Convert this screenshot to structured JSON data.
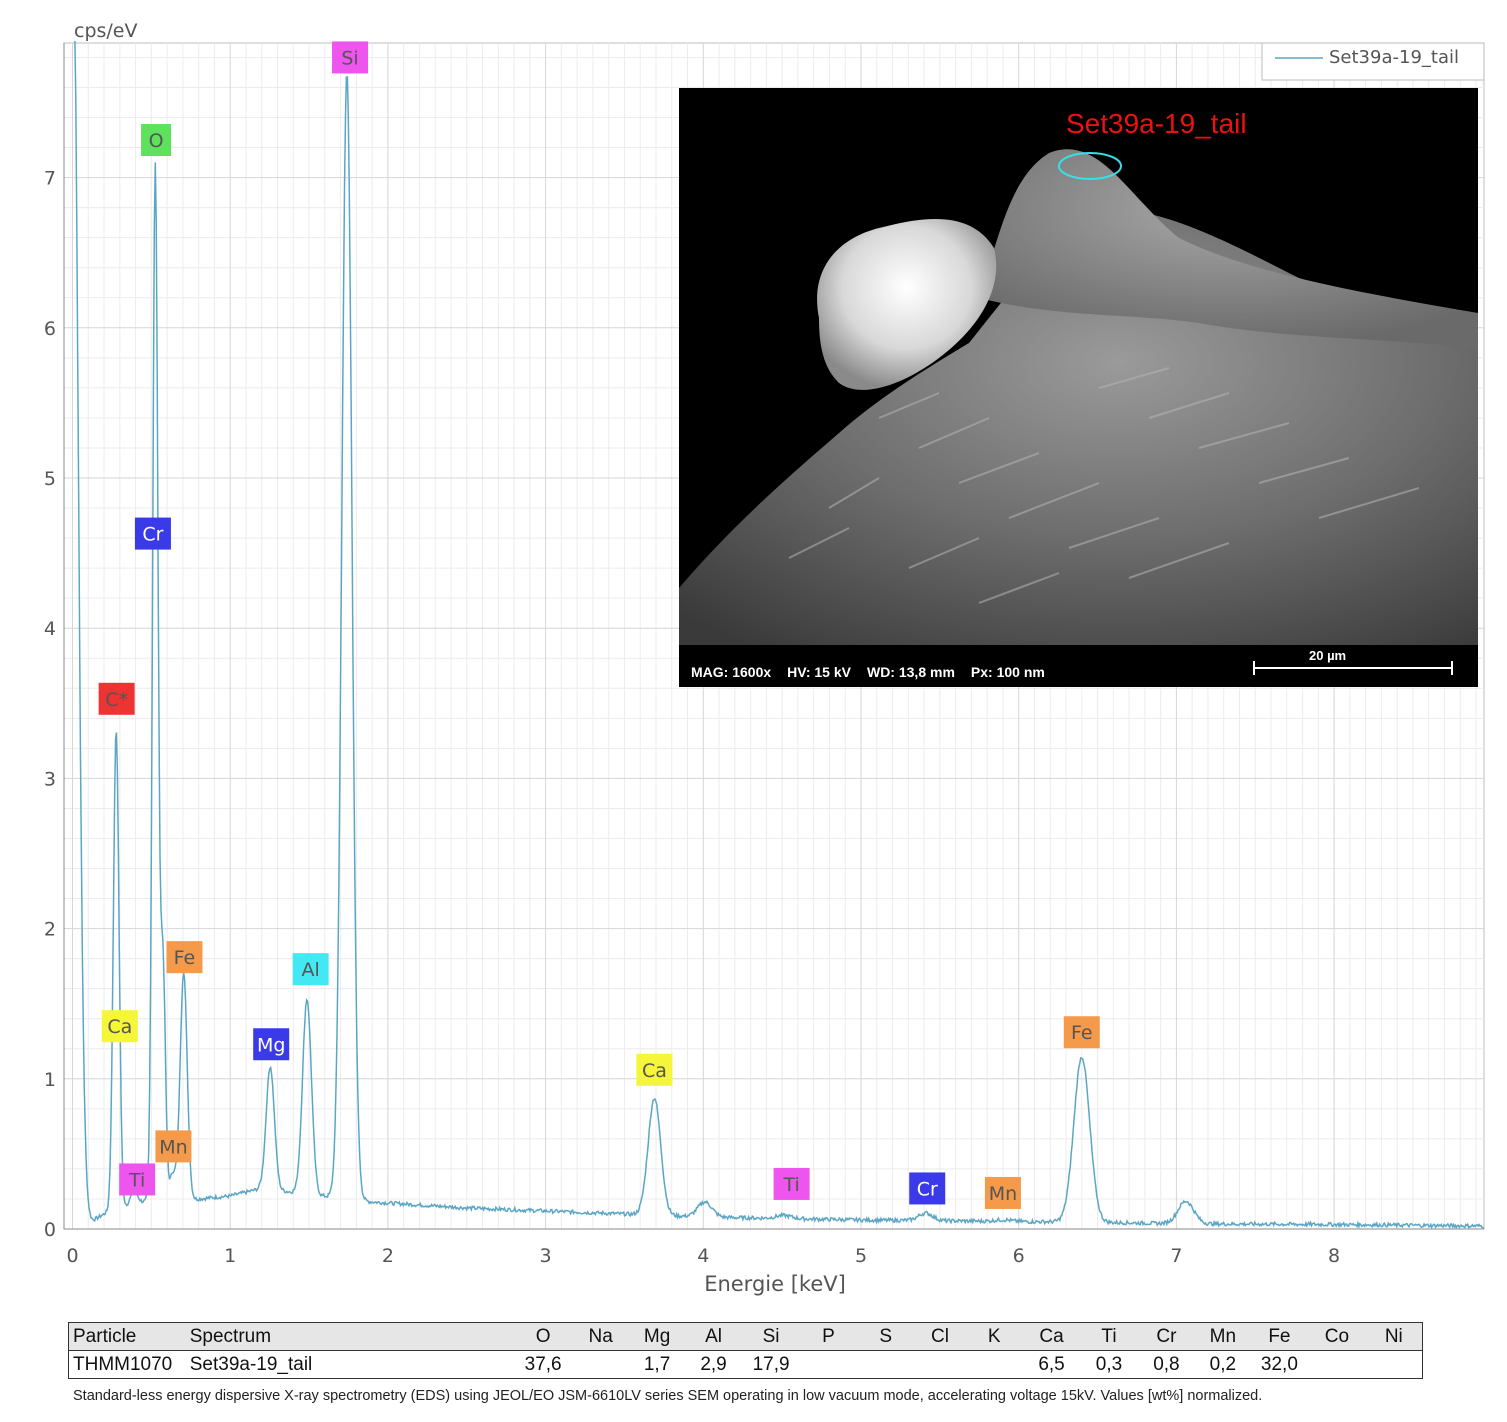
{
  "chart_data": {
    "type": "line",
    "ylabel": "cps/eV",
    "xlabel": "Energie [keV]",
    "xlim": [
      0,
      8.95
    ],
    "ylim": [
      0,
      7.9
    ],
    "x_ticks": [
      "0",
      "1",
      "2",
      "3",
      "4",
      "5",
      "6",
      "7",
      "8"
    ],
    "y_ticks": [
      "0",
      "1",
      "2",
      "3",
      "4",
      "5",
      "6",
      "7"
    ],
    "grid": true,
    "legend_position": "top-right",
    "line_color": "#5ba6c4",
    "series": [
      {
        "name": "Set39a-19_tail",
        "background": [
          [
            0.12,
            0.05
          ],
          [
            0.2,
            0.1
          ],
          [
            0.4,
            0.18
          ],
          [
            0.8,
            0.2
          ],
          [
            1.0,
            0.22
          ],
          [
            1.2,
            0.27
          ],
          [
            1.9,
            0.18
          ],
          [
            2.2,
            0.16
          ],
          [
            2.5,
            0.14
          ],
          [
            3.0,
            0.12
          ],
          [
            3.5,
            0.1
          ],
          [
            4.0,
            0.08
          ],
          [
            4.5,
            0.07
          ],
          [
            5.0,
            0.06
          ],
          [
            5.5,
            0.055
          ],
          [
            6.0,
            0.05
          ],
          [
            6.5,
            0.045
          ],
          [
            7.0,
            0.035
          ],
          [
            8.0,
            0.03
          ],
          [
            8.95,
            0.02
          ]
        ],
        "peaks": [
          {
            "x": 0.0,
            "y": 9.0,
            "w": 0.035
          },
          {
            "x": 0.277,
            "y": 3.2,
            "w": 0.018
          },
          {
            "x": 0.39,
            "y": 0.08,
            "w": 0.02
          },
          {
            "x": 0.525,
            "y": 6.9,
            "w": 0.017
          },
          {
            "x": 0.573,
            "y": 1.6,
            "w": 0.016
          },
          {
            "x": 0.637,
            "y": 0.18,
            "w": 0.02
          },
          {
            "x": 0.705,
            "y": 1.52,
            "w": 0.022
          },
          {
            "x": 1.254,
            "y": 0.82,
            "w": 0.026
          },
          {
            "x": 1.487,
            "y": 1.3,
            "w": 0.028
          },
          {
            "x": 1.74,
            "y": 7.5,
            "w": 0.032
          },
          {
            "x": 3.69,
            "y": 0.78,
            "w": 0.04
          },
          {
            "x": 4.01,
            "y": 0.1,
            "w": 0.045
          },
          {
            "x": 4.51,
            "y": 0.02,
            "w": 0.05
          },
          {
            "x": 5.41,
            "y": 0.05,
            "w": 0.045
          },
          {
            "x": 5.9,
            "y": 0.01,
            "w": 0.05
          },
          {
            "x": 6.4,
            "y": 1.1,
            "w": 0.05
          },
          {
            "x": 7.06,
            "y": 0.15,
            "w": 0.05
          }
        ]
      }
    ],
    "peak_labels": [
      {
        "label": "O",
        "x": 0.53,
        "y": 7.25,
        "color": "#5ee25e"
      },
      {
        "label": "Si",
        "x": 1.76,
        "y": 7.8,
        "color": "#ee55ee"
      },
      {
        "label": "Cr",
        "x": 0.51,
        "y": 4.63,
        "color": "#3a3ae8"
      },
      {
        "label": "C*",
        "x": 0.28,
        "y": 3.53,
        "color": "#ee3333"
      },
      {
        "label": "Fe",
        "x": 0.71,
        "y": 1.81,
        "color": "#f59a4a"
      },
      {
        "label": "Al",
        "x": 1.51,
        "y": 1.73,
        "color": "#44e8f2"
      },
      {
        "label": "Ca",
        "x": 0.3,
        "y": 1.35,
        "color": "#f5f53a"
      },
      {
        "label": "Mg",
        "x": 1.26,
        "y": 1.23,
        "color": "#3a3ae8"
      },
      {
        "label": "Mn",
        "x": 0.64,
        "y": 0.55,
        "color": "#f59a4a"
      },
      {
        "label": "Ti",
        "x": 0.41,
        "y": 0.33,
        "color": "#ee55ee"
      },
      {
        "label": "Ca",
        "x": 3.69,
        "y": 1.06,
        "color": "#f5f53a"
      },
      {
        "label": "Ti",
        "x": 4.56,
        "y": 0.3,
        "color": "#ee55ee"
      },
      {
        "label": "Cr",
        "x": 5.42,
        "y": 0.27,
        "color": "#3a3ae8"
      },
      {
        "label": "Mn",
        "x": 5.9,
        "y": 0.24,
        "color": "#f59a4a"
      },
      {
        "label": "Fe",
        "x": 6.4,
        "y": 1.31,
        "color": "#f59a4a"
      }
    ]
  },
  "sem_image": {
    "title": "Set39a-19_tail",
    "mag": "MAG: 1600x",
    "hv": "HV: 15 kV",
    "wd": "WD: 13,8 mm",
    "px": "Px: 100 nm",
    "scale": "20 µm",
    "marker_color": "#35e0e8"
  },
  "table": {
    "headers": [
      "Particle",
      "Spectrum",
      "O",
      "Na",
      "Mg",
      "Al",
      "Si",
      "P",
      "S",
      "Cl",
      "K",
      "Ca",
      "Ti",
      "Cr",
      "Mn",
      "Fe",
      "Co",
      "Ni"
    ],
    "row": [
      "THMM1070",
      "Set39a-19_tail",
      "37,6",
      "",
      "1,7",
      "2,9",
      "17,9",
      "",
      "",
      "",
      "",
      "6,5",
      "0,3",
      "0,8",
      "0,2",
      "32,0",
      "",
      ""
    ]
  },
  "caption": "Standard-less energy dispersive X-ray spectrometry (EDS) using JEOL/EO JSM-6610LV series SEM operating in low vacuum mode, accelerating voltage 15kV. Values [wt%] normalized."
}
